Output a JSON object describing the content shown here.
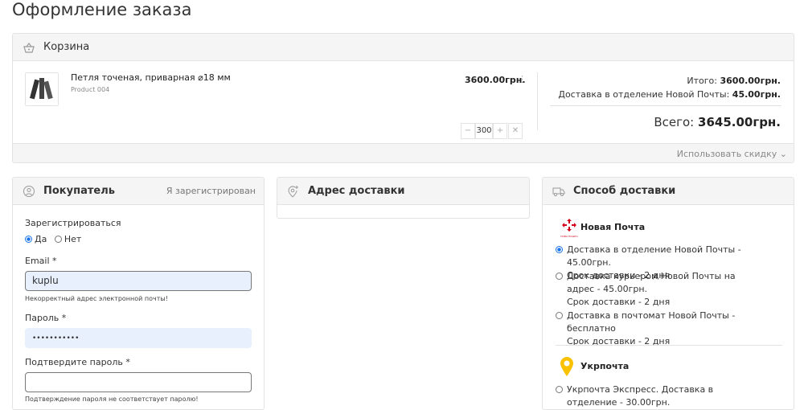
{
  "page": {
    "title": "Оформление заказа"
  },
  "cart": {
    "title": "Корзина",
    "item": {
      "name": "Петля точеная, приварная ⌀18 мм",
      "sku": "Product 004",
      "price": "3600.00грн.",
      "qty": "300"
    },
    "summary": {
      "subtotal_label": "Итого:",
      "subtotal": "3600.00грн.",
      "delivery_label": "Доставка в отделение Новой Почты:",
      "delivery": "45.00грн.",
      "total_label": "Всего:",
      "total": "3645.00грн."
    },
    "discount_link": "Использовать скидку"
  },
  "buyer": {
    "title": "Покупатель",
    "registered_link": "Я зарегистрирован",
    "register_label": "Зарегистрироваться",
    "yes": "Да",
    "no": "Нет",
    "email_label": "Email *",
    "email_value": "kuplu",
    "email_error": "Некорректный адрес электронной почты!",
    "password_label": "Пароль *",
    "password_value": "•••••••••••",
    "confirm_label": "Подтвердите пароль *",
    "confirm_value": "",
    "confirm_error": "Подтверждение пароля не соответствует паролю!"
  },
  "address": {
    "title": "Адрес доставки"
  },
  "delivery": {
    "title": "Способ доставки",
    "carriers": [
      {
        "name": "Новая Почта",
        "logo_text": "НОВА ПОШТА",
        "options": [
          {
            "text": "Доставка в отделение Новой Почты - 45.00грн.",
            "term": "Срок доставки - 2 дня",
            "selected": true
          },
          {
            "text": "Доставка курьером Новой Почты на адрес - 45.00грн.",
            "term": "Срок доставки - 2 дня",
            "selected": false
          },
          {
            "text": "Доставка в почтомат Новой Почты - бесплатно",
            "term": "Срок доставки - 2 дня",
            "selected": false
          }
        ]
      },
      {
        "name": "Укрпочта",
        "options": [
          {
            "text": "Укрпочта Экспресс. Доставка в отделение - 30.00грн.",
            "selected": false
          }
        ]
      }
    ]
  },
  "colors": {
    "accent": "#1a73e8",
    "np_red": "#d0021b",
    "ukr_yellow": "#f9c100",
    "input_autofill": "#e8f0fe"
  }
}
